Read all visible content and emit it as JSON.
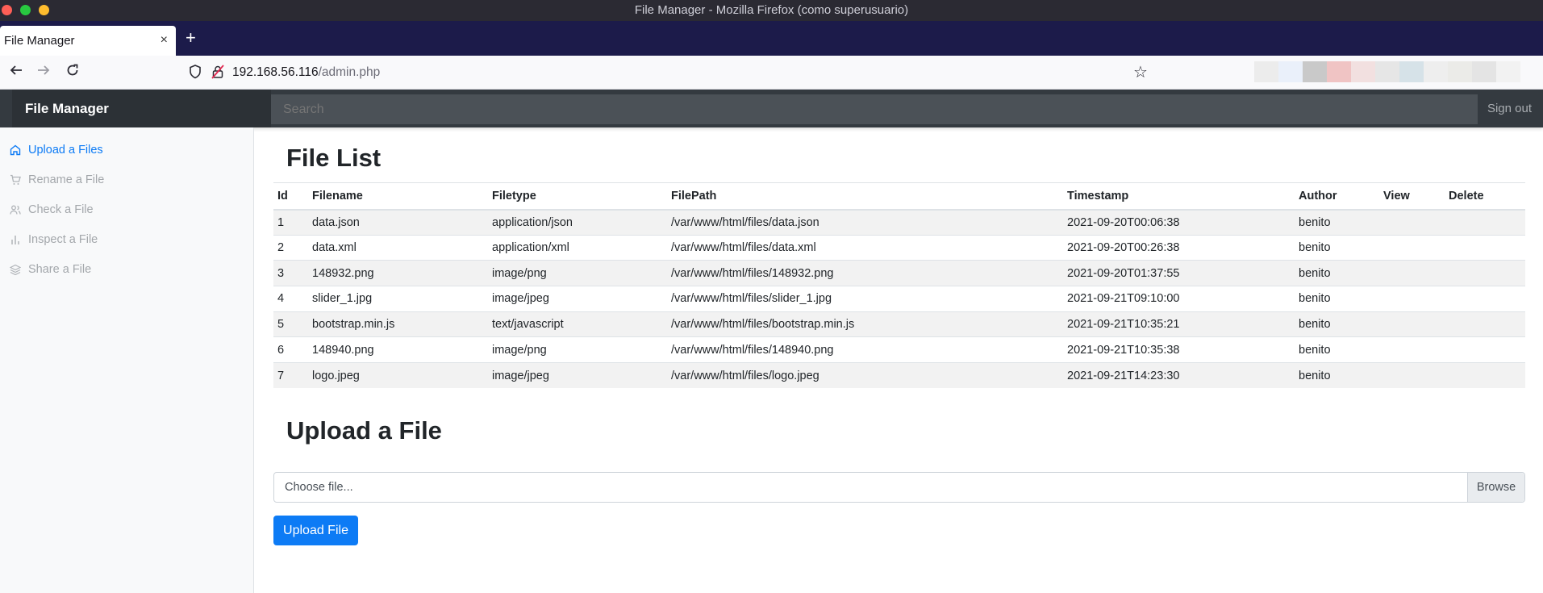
{
  "window": {
    "title": "File Manager - Mozilla Firefox (como superusuario)"
  },
  "browser": {
    "tab_title": "File Manager",
    "tab_close": "×",
    "new_tab": "+",
    "url_host": "192.168.56.116",
    "url_path": "/admin.php"
  },
  "header": {
    "brand": "File Manager",
    "search_placeholder": "Search",
    "signout": "Sign out"
  },
  "sidebar": {
    "items": [
      {
        "label": "Upload a Files",
        "icon": "home-icon",
        "active": true
      },
      {
        "label": "Rename a File",
        "icon": "cart-icon",
        "active": false
      },
      {
        "label": "Check a File",
        "icon": "users-icon",
        "active": false
      },
      {
        "label": "Inspect a File",
        "icon": "bar-chart-icon",
        "active": false
      },
      {
        "label": "Share a File",
        "icon": "layers-icon",
        "active": false
      }
    ]
  },
  "file_list": {
    "heading": "File List",
    "columns": [
      "Id",
      "Filename",
      "Filetype",
      "FilePath",
      "Timestamp",
      "Author",
      "View",
      "Delete"
    ],
    "rows": [
      [
        "1",
        "data.json",
        "application/json",
        "/var/www/html/files/data.json",
        "2021-09-20T00:06:38",
        "benito",
        "",
        ""
      ],
      [
        "2",
        "data.xml",
        "application/xml",
        "/var/www/html/files/data.xml",
        "2021-09-20T00:26:38",
        "benito",
        "",
        ""
      ],
      [
        "3",
        "148932.png",
        "image/png",
        "/var/www/html/files/148932.png",
        "2021-09-20T01:37:55",
        "benito",
        "",
        ""
      ],
      [
        "4",
        "slider_1.jpg",
        "image/jpeg",
        "/var/www/html/files/slider_1.jpg",
        "2021-09-21T09:10:00",
        "benito",
        "",
        ""
      ],
      [
        "5",
        "bootstrap.min.js",
        "text/javascript",
        "/var/www/html/files/bootstrap.min.js",
        "2021-09-21T10:35:21",
        "benito",
        "",
        ""
      ],
      [
        "6",
        "148940.png",
        "image/png",
        "/var/www/html/files/148940.png",
        "2021-09-21T10:35:38",
        "benito",
        "",
        ""
      ],
      [
        "7",
        "logo.jpeg",
        "image/jpeg",
        "/var/www/html/files/logo.jpeg",
        "2021-09-21T14:23:30",
        "benito",
        "",
        ""
      ]
    ]
  },
  "upload": {
    "heading": "Upload a File",
    "file_placeholder": "Choose file...",
    "browse_label": "Browse",
    "button_label": "Upload File"
  },
  "colors": {
    "accent": "#0d7bf5",
    "header_bg": "#343a40",
    "tabstrip_bg": "#1c1b4a"
  }
}
